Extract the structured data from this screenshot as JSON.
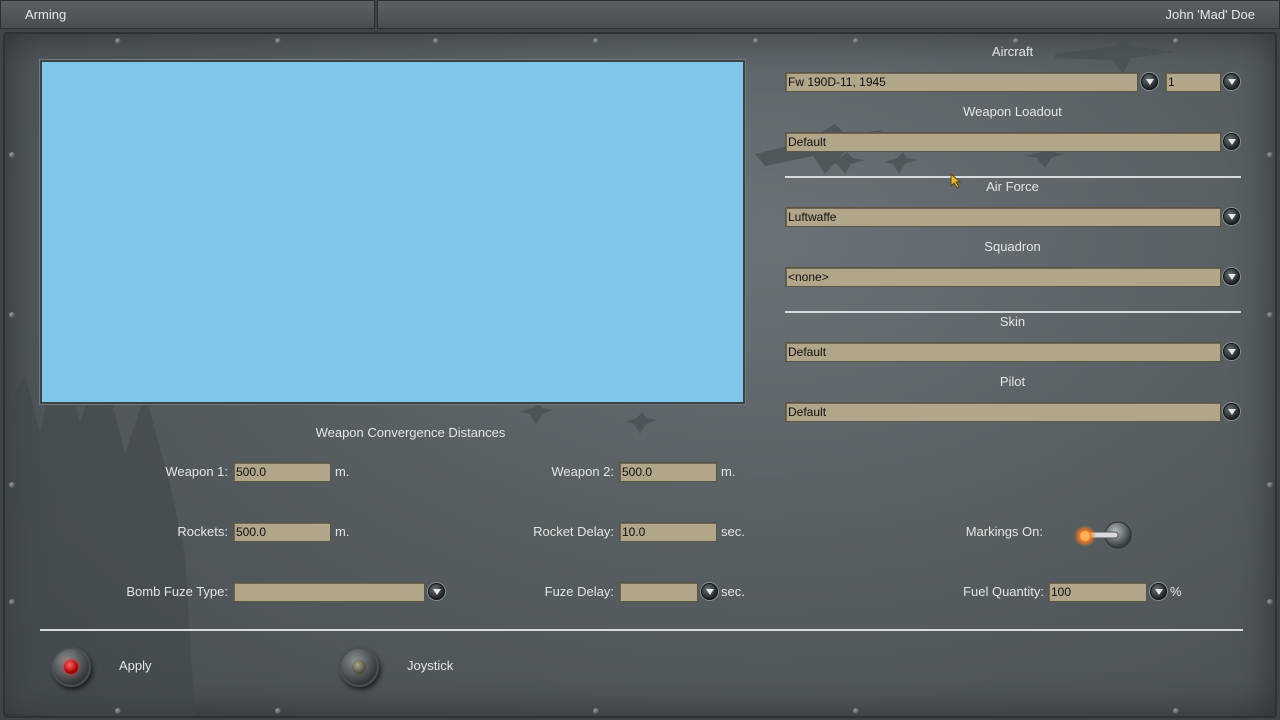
{
  "titlebar": {
    "section": "Arming",
    "user": "John 'Mad' Doe"
  },
  "aircraft": {
    "label": "Aircraft",
    "value": "Fw 190D-11, 1945",
    "count": "1"
  },
  "weapon_loadout": {
    "label": "Weapon Loadout",
    "value": "Default"
  },
  "air_force": {
    "label": "Air Force",
    "value": "Luftwaffe"
  },
  "squadron": {
    "label": "Squadron",
    "value": "<none>"
  },
  "skin": {
    "label": "Skin",
    "value": "Default"
  },
  "pilot": {
    "label": "Pilot",
    "value": "Default"
  },
  "convergence": {
    "title": "Weapon Convergence Distances",
    "weapon1_label": "Weapon 1:",
    "weapon1_value": "500.0",
    "weapon2_label": "Weapon 2:",
    "weapon2_value": "500.0",
    "rockets_label": "Rockets:",
    "rockets_value": "500.0",
    "rocket_delay_label": "Rocket Delay:",
    "rocket_delay_value": "10.0",
    "bomb_fuze_label": "Bomb Fuze Type:",
    "bomb_fuze_value": "",
    "fuze_delay_label": "Fuze Delay:",
    "fuze_delay_value": "",
    "unit_m": "m.",
    "unit_sec": "sec."
  },
  "markings": {
    "label": "Markings On:",
    "state": "on"
  },
  "fuel": {
    "label": "Fuel Quantity:",
    "value": "100",
    "unit": "%"
  },
  "buttons": {
    "apply": "Apply",
    "joystick": "Joystick"
  },
  "colors": {
    "preview_bg": "#7fc6ea",
    "field_bg": "#b1a58a",
    "panel_bg": "#585f63"
  }
}
